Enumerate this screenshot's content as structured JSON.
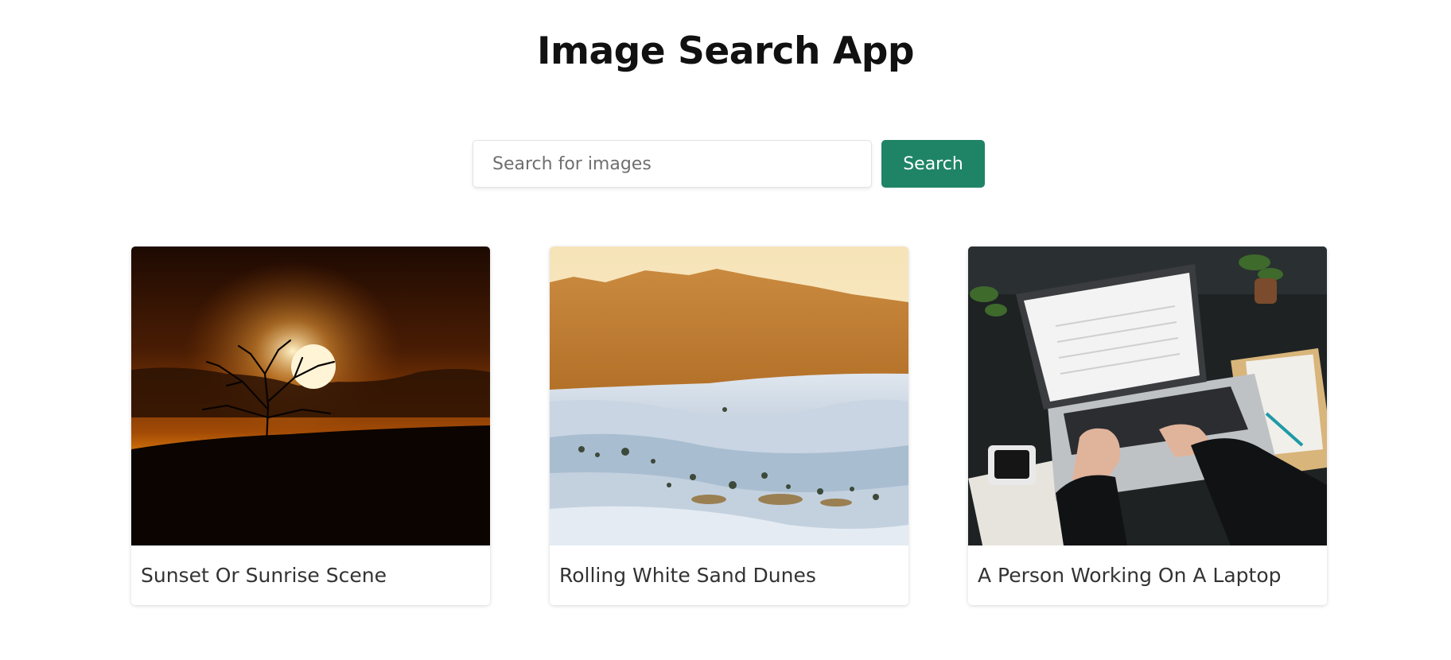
{
  "header": {
    "title": "Image Search App"
  },
  "search": {
    "placeholder": "Search for images",
    "value": "",
    "button_label": "Search"
  },
  "results": [
    {
      "caption": "Sunset Or Sunrise Scene",
      "scene": "sunset-silhouette-tree"
    },
    {
      "caption": "Rolling White Sand Dunes",
      "scene": "white-sand-dunes-mountains"
    },
    {
      "caption": "A Person Working On A Laptop",
      "scene": "hands-typing-on-laptop"
    }
  ],
  "colors": {
    "accent": "#1f8466",
    "title": "#111111",
    "caption": "#333333"
  }
}
